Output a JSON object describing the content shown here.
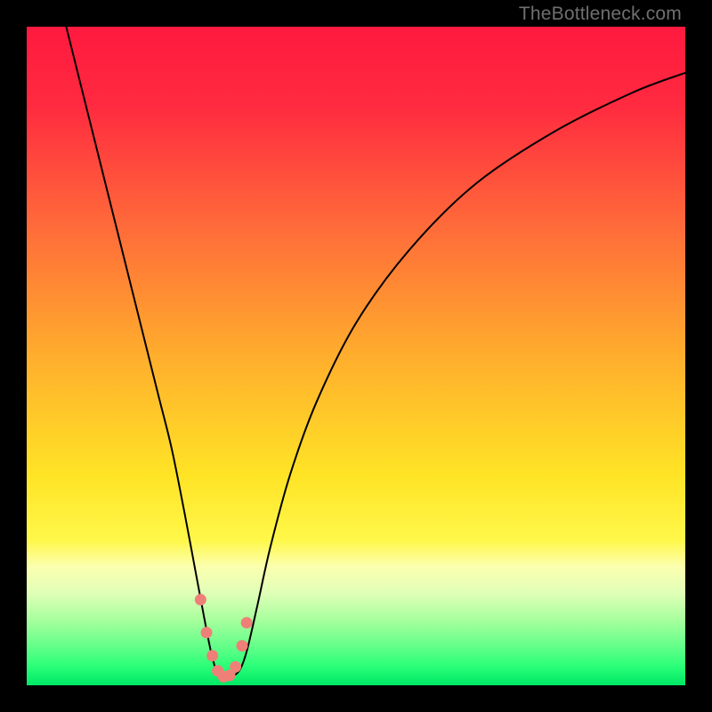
{
  "watermark": "TheBottleneck.com",
  "chart_data": {
    "type": "line",
    "title": "",
    "xlabel": "",
    "ylabel": "",
    "xlim": [
      0,
      100
    ],
    "ylim": [
      0,
      100
    ],
    "grid": false,
    "legend": false,
    "background_gradient": {
      "stops": [
        {
          "pos": 0.0,
          "color": "#ff1a3f"
        },
        {
          "pos": 0.12,
          "color": "#ff2b40"
        },
        {
          "pos": 0.3,
          "color": "#ff6a3a"
        },
        {
          "pos": 0.5,
          "color": "#ffae2d"
        },
        {
          "pos": 0.68,
          "color": "#ffe426"
        },
        {
          "pos": 0.78,
          "color": "#fff84a"
        },
        {
          "pos": 0.82,
          "color": "#fcffb0"
        },
        {
          "pos": 0.86,
          "color": "#e0ffb8"
        },
        {
          "pos": 0.9,
          "color": "#a9ff9e"
        },
        {
          "pos": 0.94,
          "color": "#66ff8a"
        },
        {
          "pos": 0.97,
          "color": "#2dff79"
        },
        {
          "pos": 1.0,
          "color": "#00e865"
        }
      ]
    },
    "series": [
      {
        "name": "bottleneck-curve",
        "color": "#000000",
        "stroke_width": 2,
        "x": [
          6,
          8,
          10,
          12,
          14,
          16,
          18,
          20,
          22,
          24,
          25.5,
          27,
          28,
          28.8,
          29.5,
          30.5,
          31.5,
          32.5,
          33.5,
          35,
          37,
          40,
          44,
          50,
          58,
          68,
          80,
          92,
          100
        ],
        "y": [
          100,
          92,
          84,
          76,
          68,
          60,
          52,
          44,
          36,
          26,
          18,
          10,
          5,
          2.2,
          1.4,
          1.2,
          1.5,
          2.6,
          5.5,
          12,
          21,
          32,
          43,
          55,
          66,
          76,
          84,
          90,
          93
        ]
      }
    ],
    "markers": {
      "name": "valley-dots",
      "color": "#ef8078",
      "radius": 6.5,
      "x": [
        26.4,
        27.3,
        28.2,
        29.0,
        29.9,
        30.8,
        31.7,
        32.7,
        33.4
      ],
      "y": [
        13.0,
        8.0,
        4.5,
        2.2,
        1.3,
        1.5,
        2.8,
        6.0,
        9.5
      ]
    }
  }
}
